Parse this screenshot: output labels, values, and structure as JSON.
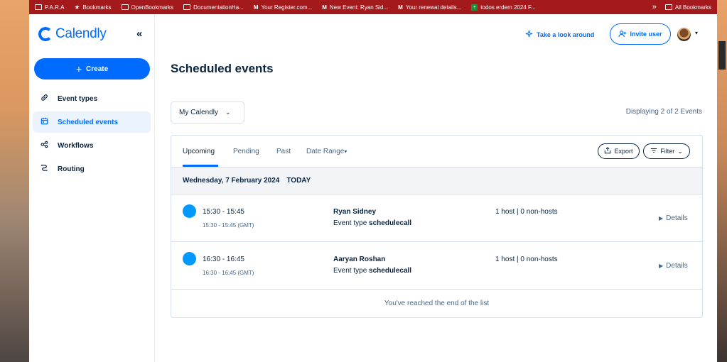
{
  "bookmarks": {
    "items": [
      {
        "label": "P.A.R.A",
        "icon": "folder-icon"
      },
      {
        "label": "Bookmarks",
        "icon": "star-icon"
      },
      {
        "label": "OpenBookmarks",
        "icon": "folder-icon"
      },
      {
        "label": "DocumentationHa...",
        "icon": "folder-icon"
      },
      {
        "label": "Your Register.com...",
        "icon": "gmail-icon"
      },
      {
        "label": "New Event: Ryan Sid...",
        "icon": "gmail-icon"
      },
      {
        "label": "Your renewal details...",
        "icon": "gmail-icon"
      },
      {
        "label": "todos erdem 2024 F...",
        "icon": "sheets-icon"
      }
    ],
    "overflow": "»",
    "all_bookmarks": "All Bookmarks"
  },
  "sidebar": {
    "logo": "Calendly",
    "collapse": "«",
    "create_label": "Create",
    "create_plus": "+",
    "items": [
      {
        "label": "Event types",
        "icon": "link-icon"
      },
      {
        "label": "Scheduled events",
        "icon": "calendar-icon"
      },
      {
        "label": "Workflows",
        "icon": "workflow-icon"
      },
      {
        "label": "Routing",
        "icon": "routing-icon"
      }
    ]
  },
  "header": {
    "look_around": "Take a look around",
    "invite": "Invite user",
    "caret": "▾"
  },
  "main": {
    "title": "Scheduled events",
    "calendar_select": "My Calendly",
    "chevron": "⌄",
    "displaying": "Displaying 2 of 2 Events",
    "tabs": [
      {
        "label": "Upcoming"
      },
      {
        "label": "Pending"
      },
      {
        "label": "Past"
      },
      {
        "label": "Date Range"
      }
    ],
    "date_range_caret": "▾",
    "export_label": "Export",
    "filter_label": "Filter",
    "filter_caret": "⌄",
    "date_header": "Wednesday, 7 February 2024",
    "today_label": "TODAY",
    "events": [
      {
        "time": "15:30 - 15:45",
        "time_sub": "15:30 - 15:45 (GMT)",
        "name": "Ryan Sidney",
        "type_prefix": "Event type",
        "type_value": "schedulecall",
        "hosts": "1 host | 0 non-hosts",
        "details_label": "Details"
      },
      {
        "time": "16:30 - 16:45",
        "time_sub": "16:30 - 16:45 (GMT)",
        "name": "Aaryan Roshan",
        "type_prefix": "Event type",
        "type_value": "schedulecall",
        "hosts": "1 host | 0 non-hosts",
        "details_label": "Details"
      }
    ],
    "end_of_list": "You've reached the end of the list"
  },
  "colors": {
    "brand": "#006bff",
    "event_dot": "#0099ff",
    "bookmarks_bar": "#a3191c"
  }
}
